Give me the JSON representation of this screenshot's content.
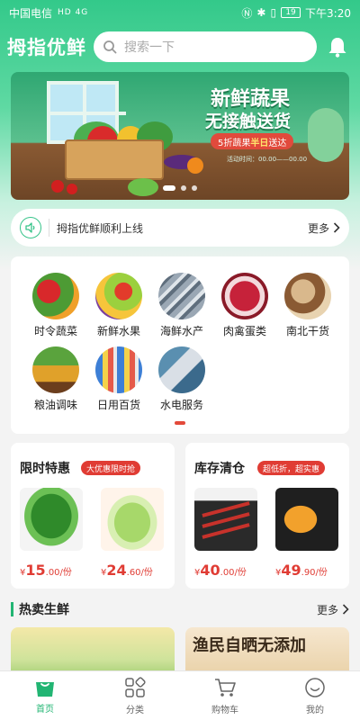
{
  "status": {
    "carrier": "中国电信",
    "signal": "HD 4G",
    "battery": "19",
    "time": "下午3:20"
  },
  "header": {
    "logo": "拇指优鲜",
    "search_placeholder": "搜索一下"
  },
  "banner": {
    "headline": "新鲜蔬果",
    "subline": "无接触送货",
    "tag_prefix": "5折蔬果",
    "tag_highlight": "半日",
    "tag_suffix": "送达",
    "time_text": "活动时间：00.00——00.00"
  },
  "notice": {
    "text": "拇指优鲜顺利上线",
    "more": "更多"
  },
  "categories": [
    {
      "label": "时令蔬菜",
      "icon": "vegetables"
    },
    {
      "label": "新鲜水果",
      "icon": "fruits"
    },
    {
      "label": "海鲜水产",
      "icon": "seafood"
    },
    {
      "label": "肉禽蛋类",
      "icon": "meat"
    },
    {
      "label": "南北干货",
      "icon": "dry-goods"
    },
    {
      "label": "粮油调味",
      "icon": "grain-oil"
    },
    {
      "label": "日用百货",
      "icon": "daily-goods"
    },
    {
      "label": "水电服务",
      "icon": "utility-service"
    }
  ],
  "promo_left": {
    "title": "限时特惠",
    "badge": "大优惠限时抢",
    "products": [
      {
        "price_symbol": "¥",
        "price_int": "15",
        "price_dec": ".00/份"
      },
      {
        "price_symbol": "¥",
        "price_int": "24",
        "price_dec": ".60/份"
      }
    ]
  },
  "promo_right": {
    "title": "库存清仓",
    "badge": "超低折，超实惠",
    "products": [
      {
        "price_symbol": "¥",
        "price_int": "40",
        "price_dec": ".00/份"
      },
      {
        "price_symbol": "¥",
        "price_int": "49",
        "price_dec": ".90/份"
      }
    ]
  },
  "hot": {
    "title": "热卖生鲜",
    "more": "更多",
    "card_right_text": "渔民自晒无添加"
  },
  "tabs": [
    {
      "label": "首页",
      "active": true
    },
    {
      "label": "分类",
      "active": false
    },
    {
      "label": "购物车",
      "active": false
    },
    {
      "label": "我的",
      "active": false
    }
  ],
  "colors": {
    "accent": "#22b573",
    "red": "#e03c34",
    "header_green": "#33c98a"
  }
}
